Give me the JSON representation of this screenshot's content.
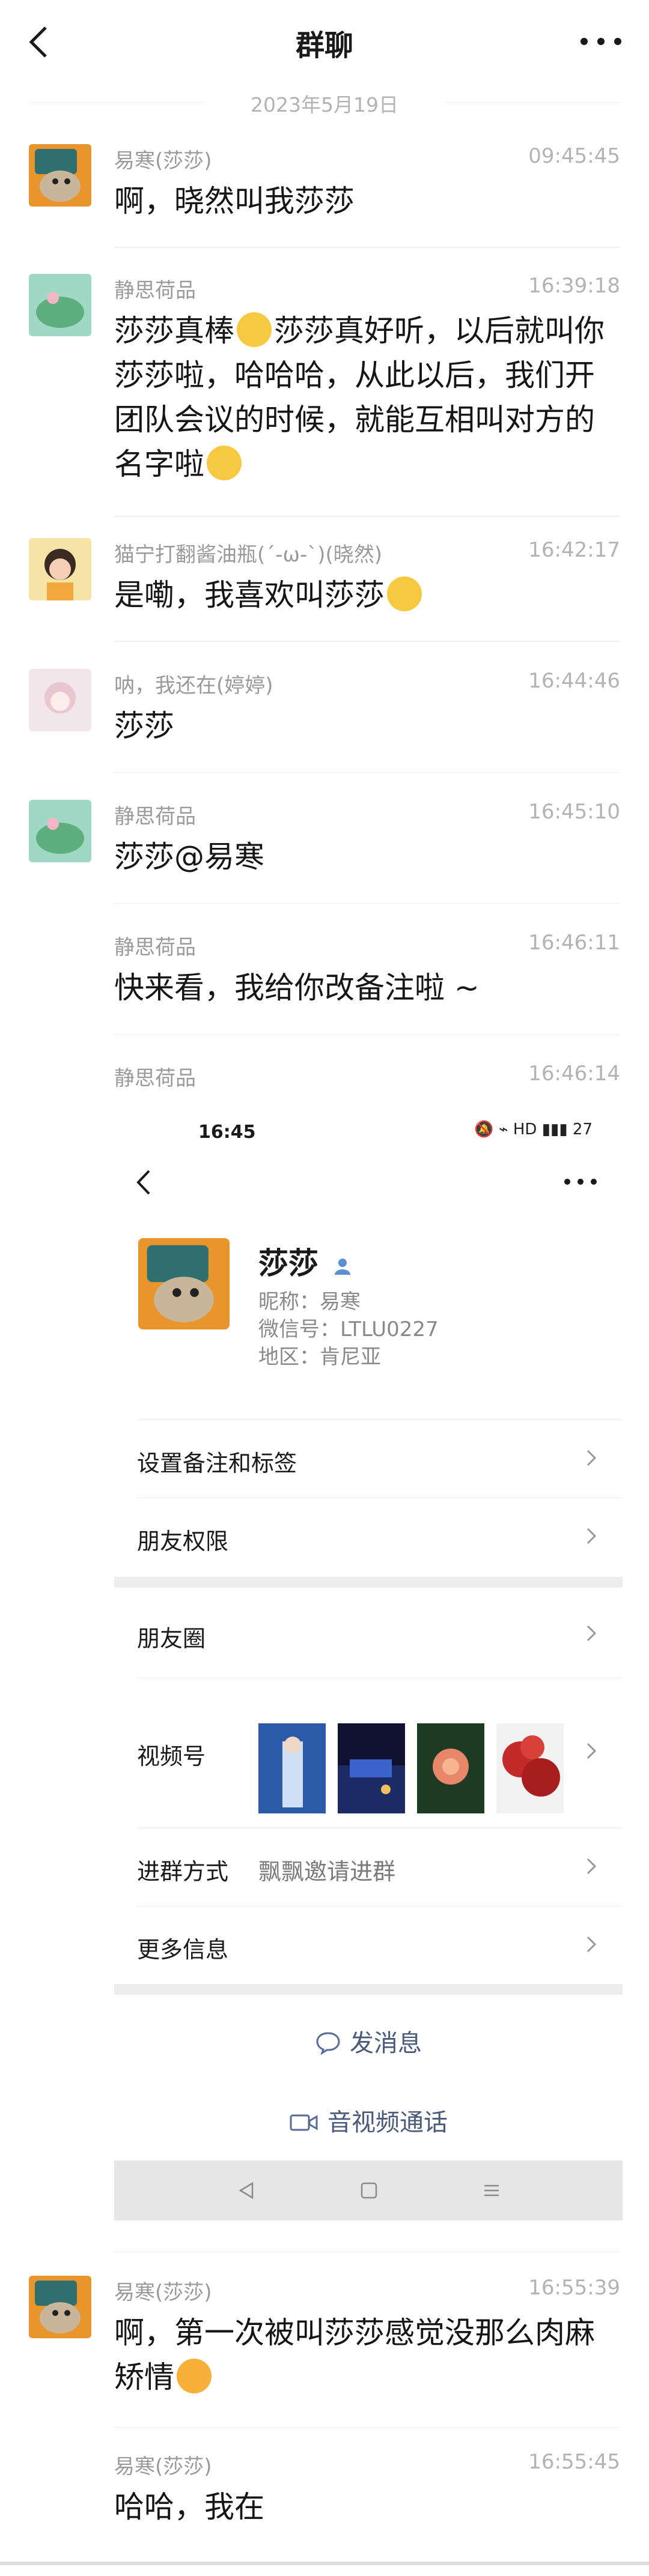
{
  "header": {
    "title": "群聊",
    "back_icon": "back-arrow-icon",
    "more_icon": "more-dots-icon"
  },
  "date_divider": "2023年5月19日",
  "messages": [
    {
      "name": "易寒(莎莎)",
      "time": "09:45:45",
      "text": "啊，晓然叫我莎莎"
    },
    {
      "name": "静思荷品",
      "time": "16:39:18",
      "text_parts": [
        "莎莎真棒",
        "莎莎真好听，以后就叫你莎莎啦，哈哈哈，从此以后，我们开团队会议的时候，就能互相叫对方的名字啦"
      ]
    },
    {
      "name": "猫宁打翻酱油瓶(´-ω-`)(晓然)",
      "time": "16:42:17",
      "text": "是嘞，我喜欢叫莎莎"
    },
    {
      "name": "呐，我还在(婷婷)",
      "time": "16:44:46",
      "text": "莎莎"
    },
    {
      "name": "静思荷品",
      "time": "16:45:10",
      "text": "莎莎@易寒"
    },
    {
      "name": "静思荷品",
      "time": "16:46:11",
      "text": "快来看，我给你改备注啦 ~"
    },
    {
      "name": "静思荷品",
      "time": "16:46:14"
    },
    {
      "name": "易寒(莎莎)",
      "time": "16:55:39",
      "text": "啊，第一次被叫莎莎感觉没那么肉麻矫情"
    },
    {
      "name": "易寒(莎莎)",
      "time": "16:55:45",
      "text": "哈哈，我在"
    }
  ],
  "screenshot": {
    "status_time": "16:45",
    "status_icons": "🔕 ⌁ HD ▮▮▮ 27",
    "profile_name": "莎莎",
    "nickname": "昵称：易寒",
    "wechat_id": "微信号：LTLU0227",
    "region": "地区：肯尼亚",
    "rows": {
      "remark": "设置备注和标签",
      "permission": "朋友权限",
      "moments": "朋友圈",
      "channels": "视频号",
      "join_method": "进群方式",
      "join_value": "飘飘邀请进群",
      "more_info": "更多信息"
    },
    "send_message": "发消息",
    "video_call": "音视频通话",
    "accent_color": "#576b95"
  }
}
